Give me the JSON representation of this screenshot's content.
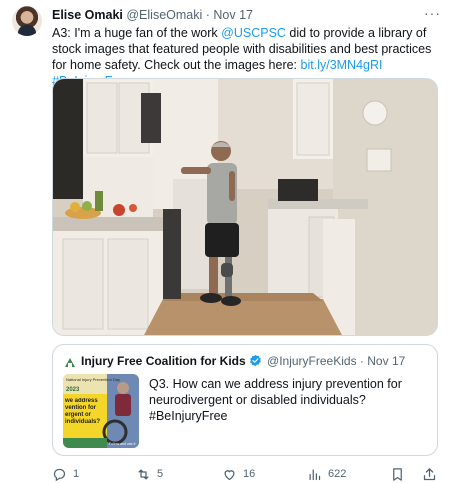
{
  "tweet": {
    "display_name": "Elise Omaki",
    "handle": "@EliseOmaki",
    "date": "Nov 17",
    "separator": "·",
    "text_prefix": "A3: I'm a huge fan of the work ",
    "mention": "@USCPSC",
    "text_middle": " did to provide a library of stock images that featured people with disabilities and best practices for home safety. Check out the images here: ",
    "url": "bit.ly/3MN4gRI",
    "hashtag": "#BeInjuryFree"
  },
  "quote": {
    "display_name": "Injury Free Coalition for Kids",
    "handle": "@InjuryFreeKids",
    "date": "Nov 17",
    "separator": "·",
    "text": "Q3. How can we address injury prevention for neurodivergent or disabled individuals? #BeInjuryFree",
    "thumb": {
      "line1": "National Injury Prevention Day",
      "line2": "2023",
      "line3": "we address vention for ergent or individuals?",
      "line4": "Follow and use #"
    }
  },
  "actions": {
    "replies": "1",
    "retweets": "5",
    "likes": "16",
    "views": "622"
  },
  "colors": {
    "link": "#1d9bf0",
    "muted": "#536471",
    "verified": "#1d9bf0",
    "border": "#cfd9de"
  },
  "icons": [
    "more-icon",
    "reply-icon",
    "retweet-icon",
    "like-icon",
    "views-icon",
    "bookmark-icon",
    "share-icon",
    "verified-icon"
  ]
}
